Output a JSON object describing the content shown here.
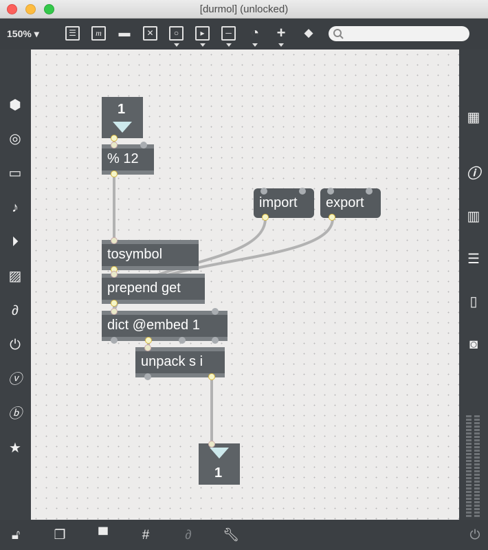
{
  "window": {
    "title": "[durmol] (unlocked)"
  },
  "toolbar": {
    "zoom": "150%",
    "search_placeholder": ""
  },
  "patch": {
    "number_in": "1",
    "number_out": "1",
    "objects": {
      "mod": "% 12",
      "tosymbol": "tosymbol",
      "prepend": "prepend get",
      "dict": "dict @embed 1",
      "unpack": "unpack s i"
    },
    "messages": {
      "import": "import",
      "export": "export"
    }
  },
  "colors": {
    "canvas": "#edeceb",
    "object": "#595e62",
    "chrome": "#3d4145",
    "close": "#fc605b",
    "minimize": "#fdbc40",
    "zoom": "#34c84a"
  }
}
